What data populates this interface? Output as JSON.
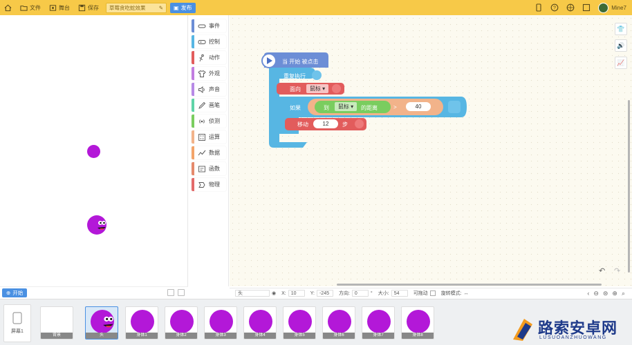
{
  "topbar": {
    "home_label": "",
    "file_label": "文件",
    "stage_label": "舞台",
    "save_label": "保存",
    "project_title": "草莓贪吃蛇效果",
    "publish_label": "发布",
    "username": "Mine7"
  },
  "stage": {
    "start_label": "开始"
  },
  "categories": [
    {
      "label": "事件",
      "color": "#6c8ed6",
      "icon": "event-icon"
    },
    {
      "label": "控制",
      "color": "#57b6e3",
      "icon": "gamepad-icon"
    },
    {
      "label": "动作",
      "color": "#e25c5c",
      "icon": "motion-icon"
    },
    {
      "label": "外观",
      "color": "#c27de0",
      "icon": "shirt-icon"
    },
    {
      "label": "声音",
      "color": "#b78ae6",
      "icon": "sound-icon"
    },
    {
      "label": "画笔",
      "color": "#5fd4a8",
      "icon": "pen-icon"
    },
    {
      "label": "侦测",
      "color": "#7acd5f",
      "icon": "sensor-icon"
    },
    {
      "label": "运算",
      "color": "#f2b38a",
      "icon": "calculator-icon"
    },
    {
      "label": "数据",
      "color": "#f3a46a",
      "icon": "data-icon"
    },
    {
      "label": "函数",
      "color": "#e58a6c",
      "icon": "function-icon"
    },
    {
      "label": "物理",
      "color": "#e36b6b",
      "icon": "physics-icon"
    }
  ],
  "blocks": {
    "when_start": "当 开始 被点击",
    "forever": "重复执行",
    "face_label": "面向",
    "face_target": "鼠标",
    "if_label": "如果",
    "to_label": "到",
    "distance_target": "鼠标",
    "distance_label": "的距离",
    "compare_op": ">",
    "compare_value": "40",
    "move_label": "移动",
    "move_steps": "12",
    "steps_label": "步"
  },
  "infobar": {
    "sprite_name": "头",
    "x_label": "X:",
    "x_value": "10",
    "y_label": "Y:",
    "y_value": "-245",
    "dir_label": "方向:",
    "dir_value": "0",
    "size_label": "大小:",
    "size_value": "54",
    "drag_label": "可拖动",
    "rotate_label": "旋转模式:",
    "rotate_value": "↔"
  },
  "bottom": {
    "scene_label": "屏幕1",
    "sprites": [
      "背景",
      "头",
      "身体1",
      "身体2",
      "身体3",
      "身体4",
      "身体5",
      "身体6",
      "身体7",
      "身体8"
    ]
  },
  "watermark": {
    "title": "路索安卓网",
    "subtitle": "LUSUOANZHUOWANG"
  },
  "colors": {
    "topbar": "#f7c948",
    "event_block": "#6c8ed6",
    "control_block": "#57b6e3",
    "motion_block": "#e25c5c",
    "sensor_block": "#7acd5f",
    "operator_block": "#f2b38a",
    "sprite": "#b318d8"
  }
}
